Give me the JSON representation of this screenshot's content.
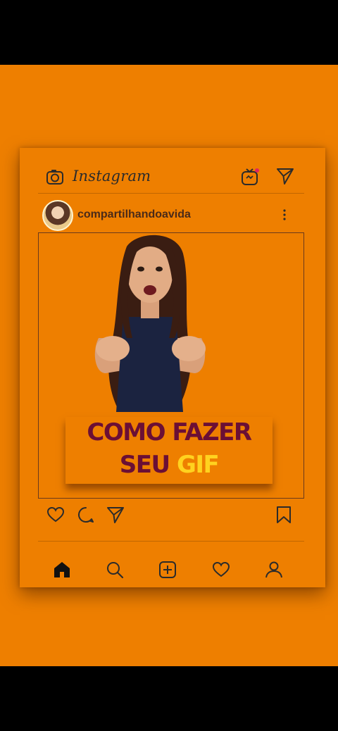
{
  "app": {
    "name": "Instagram"
  },
  "post": {
    "username": "compartilhandoavida",
    "caption": {
      "line1": "COMO FAZER",
      "line2_a": "SEU ",
      "line2_b": "GIF"
    }
  },
  "colors": {
    "background": "#ee7f00",
    "caption_primary": "#6b0f35",
    "caption_highlight": "#ffd21f",
    "icon": "#2b2b2b"
  },
  "icons": {
    "header": [
      "camera-icon",
      "igtv-icon",
      "direct-message-icon"
    ],
    "post": [
      "more-icon"
    ],
    "actions": [
      "heart-icon",
      "comment-icon",
      "share-icon",
      "bookmark-icon"
    ],
    "nav": [
      "home-icon",
      "search-icon",
      "add-post-icon",
      "activity-heart-icon",
      "profile-icon"
    ]
  }
}
